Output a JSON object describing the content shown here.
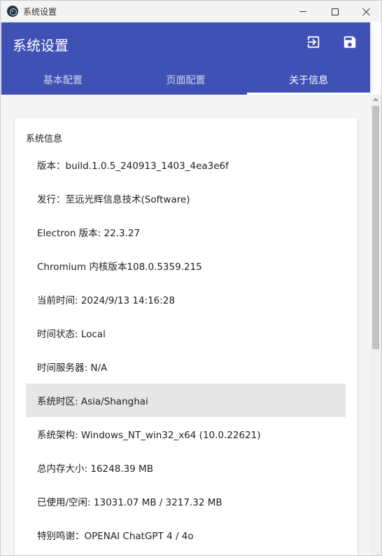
{
  "window": {
    "title": "系统设置"
  },
  "header": {
    "title": "系统设置",
    "tabs": [
      {
        "label": "基本配置"
      },
      {
        "label": "页面配置"
      },
      {
        "label": "关于信息"
      }
    ],
    "active_tab": "关于信息",
    "accent_color": "#3f51b5"
  },
  "icons": {
    "exit": "exit-to-app-icon",
    "save": "save-icon"
  },
  "info": {
    "title": "系统信息",
    "items": [
      "版本：build.1.0.5_240913_1403_4ea3e6f",
      "发行：至远光辉信息技术(Software)",
      "Electron 版本: 22.3.27",
      "Chromium 内核版本108.0.5359.215",
      "当前时间: 2024/9/13 14:16:28",
      "时间状态: Local",
      "时间服务器: N/A",
      "系统时区: Asia/Shanghai",
      "系统架构: Windows_NT_win32_x64 (10.0.22621)",
      "总内存大小: 16248.39 MB",
      "已使用/空闲: 13031.07 MB / 3217.32 MB",
      "特别鸣谢：OPENAI ChatGPT 4 / 4o"
    ]
  }
}
